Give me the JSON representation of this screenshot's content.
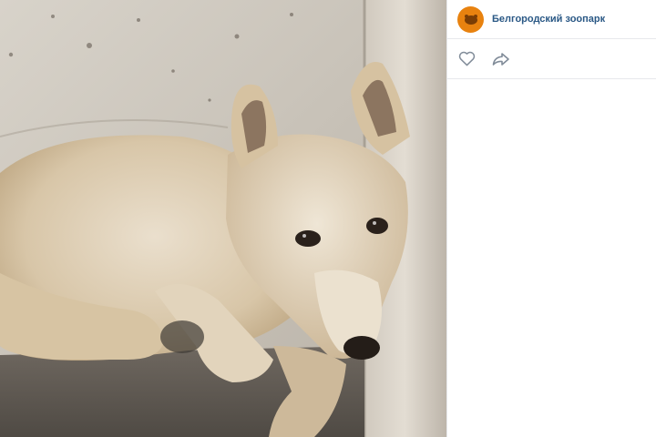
{
  "photo": {
    "subject": "wolf-cub-photo"
  },
  "post": {
    "author": {
      "name": "Белгородский зоопарк",
      "avatar_icon": "zoo-logo-icon",
      "avatar_color": "#e8820f"
    },
    "actions": {
      "like_icon": "heart-icon",
      "share_icon": "share-arrow-icon"
    }
  },
  "colors": {
    "link": "#2a5885",
    "icon": "#818c99",
    "divider": "#e7e8ec"
  }
}
